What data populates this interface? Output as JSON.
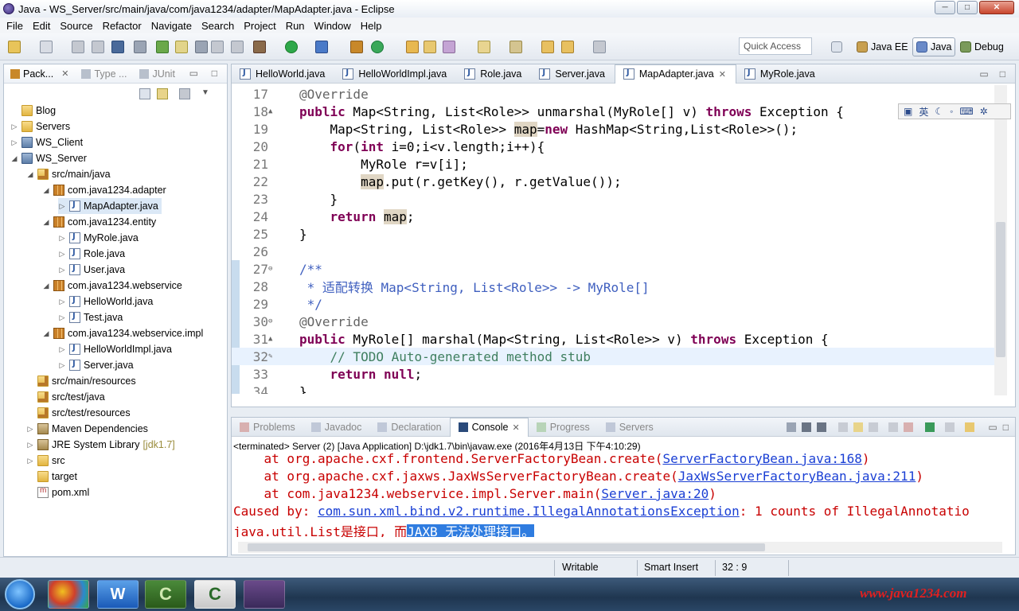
{
  "window": {
    "title": "Java - WS_Server/src/main/java/com/java1234/adapter/MapAdapter.java - Eclipse",
    "btn_min": "─",
    "btn_max": "□",
    "btn_close": "✕"
  },
  "menu": [
    "File",
    "Edit",
    "Source",
    "Refactor",
    "Navigate",
    "Search",
    "Project",
    "Run",
    "Window",
    "Help"
  ],
  "quick_access": "Quick Access",
  "perspectives": {
    "javaee": "Java EE",
    "java": "Java",
    "debug": "Debug"
  },
  "package_explorer": {
    "tabs": [
      "Pack...",
      "Type ...",
      "JUnit"
    ],
    "items": [
      {
        "label": "Blog",
        "extra": ""
      },
      {
        "label": "Servers",
        "extra": ""
      },
      {
        "label": "WS_Client",
        "extra": ""
      },
      {
        "label": "WS_Server",
        "extra": ""
      },
      {
        "label": "src/main/java",
        "extra": ""
      },
      {
        "label": "com.java1234.adapter",
        "extra": ""
      },
      {
        "label": "MapAdapter.java",
        "extra": ""
      },
      {
        "label": "com.java1234.entity",
        "extra": ""
      },
      {
        "label": "MyRole.java",
        "extra": ""
      },
      {
        "label": "Role.java",
        "extra": ""
      },
      {
        "label": "User.java",
        "extra": ""
      },
      {
        "label": "com.java1234.webservice",
        "extra": ""
      },
      {
        "label": "HelloWorld.java",
        "extra": ""
      },
      {
        "label": "Test.java",
        "extra": ""
      },
      {
        "label": "com.java1234.webservice.impl",
        "extra": ""
      },
      {
        "label": "HelloWorldImpl.java",
        "extra": ""
      },
      {
        "label": "Server.java",
        "extra": ""
      },
      {
        "label": "src/main/resources",
        "extra": ""
      },
      {
        "label": "src/test/java",
        "extra": ""
      },
      {
        "label": "src/test/resources",
        "extra": ""
      },
      {
        "label": "Maven Dependencies",
        "extra": ""
      },
      {
        "label": "JRE System Library",
        "extra": "[jdk1.7]"
      },
      {
        "label": "src",
        "extra": ""
      },
      {
        "label": "target",
        "extra": ""
      },
      {
        "label": "pom.xml",
        "extra": ""
      }
    ]
  },
  "editor": {
    "tabs": [
      "HelloWorld.java",
      "HelloWorldImpl.java",
      "Role.java",
      "Server.java",
      "MapAdapter.java",
      "MyRole.java"
    ],
    "active_tab": "MapAdapter.java",
    "lines": [
      {
        "n": "17",
        "text": "@Override"
      },
      {
        "n": "18",
        "text": "public Map<String, List<Role>> unmarshal(MyRole[] v) throws Exception {"
      },
      {
        "n": "19",
        "text": "    Map<String, List<Role>> map=new HashMap<String,List<Role>>();"
      },
      {
        "n": "20",
        "text": "    for(int i=0;i<v.length;i++){"
      },
      {
        "n": "21",
        "text": "        MyRole r=v[i];"
      },
      {
        "n": "22",
        "text": "        map.put(r.getKey(), r.getValue());"
      },
      {
        "n": "23",
        "text": "    }"
      },
      {
        "n": "24",
        "text": "    return map;"
      },
      {
        "n": "25",
        "text": "}"
      },
      {
        "n": "26",
        "text": ""
      },
      {
        "n": "27",
        "text": "/**"
      },
      {
        "n": "28",
        "text": " * 适配转换 Map<String, List<Role>> -> MyRole[]"
      },
      {
        "n": "29",
        "text": " */"
      },
      {
        "n": "30",
        "text": "@Override"
      },
      {
        "n": "31",
        "text": "public MyRole[] marshal(Map<String, List<Role>> v) throws Exception {"
      },
      {
        "n": "32",
        "text": "    // TODO Auto-generated method stub"
      },
      {
        "n": "33",
        "text": "    return null;"
      },
      {
        "n": "34",
        "text": "}"
      }
    ]
  },
  "ime_toolbar": {
    "mode": "英"
  },
  "console": {
    "tabs": [
      "Problems",
      "Javadoc",
      "Declaration",
      "Console",
      "Progress",
      "Servers"
    ],
    "active_tab": "Console",
    "status": "<terminated> Server (2) [Java Application] D:\\jdk1.7\\bin\\javaw.exe (2016年4月13日 下午4:10:29)",
    "line1_pre": "    at org.apache.cxf.frontend.ServerFactoryBean.create(",
    "line1_link": "ServerFactoryBean.java:168",
    "line1_post": ")",
    "line2_pre": "    at org.apache.cxf.jaxws.JaxWsServerFactoryBean.create(",
    "line2_link": "JaxWsServerFactoryBean.java:211",
    "line2_post": ")",
    "line3_pre": "    at com.java1234.webservice.impl.Server.main(",
    "line3_link": "Server.java:20",
    "line3_post": ")",
    "line4_pre": "Caused by: ",
    "line4_link": "com.sun.xml.bind.v2.runtime.IllegalAnnotationsException",
    "line4_post": ": 1 counts of IllegalAnnotatio",
    "line5_pre": "java.util.List是接口, 而",
    "line5_sel": "JAXB 无法处理接口。"
  },
  "statusbar": {
    "writable": "Writable",
    "insert_mode": "Smart Insert",
    "position": "32 : 9"
  },
  "watermark": "www.java1234.com",
  "colors": {
    "keyword": "#7f0055",
    "annotation": "#646464",
    "javadoc": "#3f5fbf",
    "comment": "#3f7f5f",
    "console_error": "#c80000",
    "link": "#1a3fd4"
  }
}
